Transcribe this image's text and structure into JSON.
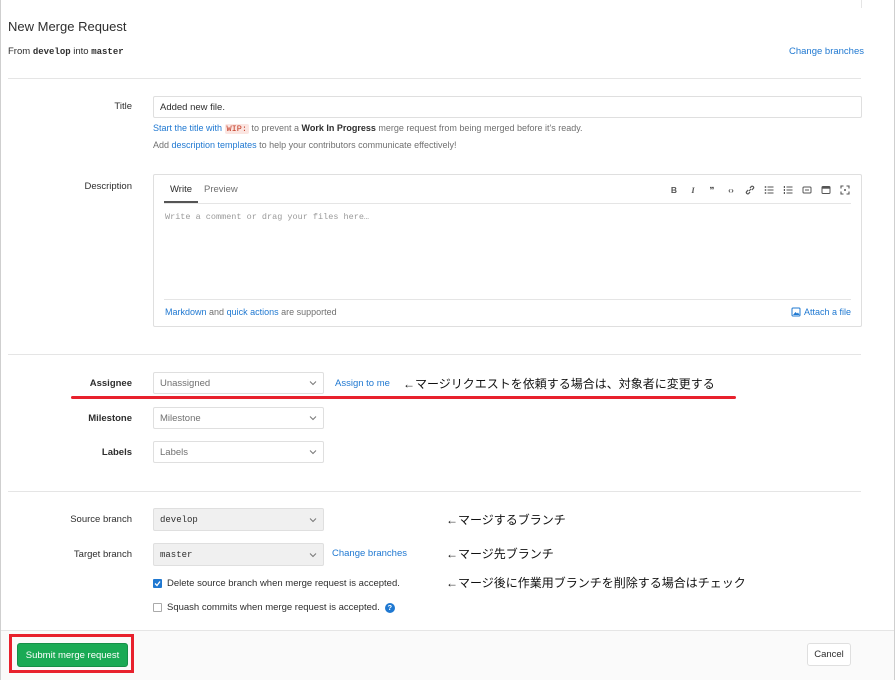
{
  "header": {
    "title": "New Merge Request",
    "from_prefix": "From",
    "source": "develop",
    "into": "into",
    "target": "master",
    "change_branches": "Change branches"
  },
  "title_field": {
    "label": "Title",
    "value": "Added new file.",
    "help1_start": "Start the title with",
    "wip_code": "WIP:",
    "help1_mid": "to prevent a",
    "help1_bold": "Work In Progress",
    "help1_end": "merge request from being merged before it's ready.",
    "help2_start": "Add",
    "help2_link": "description templates",
    "help2_end": "to help your contributors communicate effectively!"
  },
  "description": {
    "label": "Description",
    "tab_write": "Write",
    "tab_preview": "Preview",
    "toolbar": {
      "bold": "B",
      "italic": "I",
      "quote": "❞",
      "code": "‹›"
    },
    "placeholder": "Write a comment or drag your files here…",
    "footer_link1": "Markdown",
    "footer_and": "and",
    "footer_link2": "quick actions",
    "footer_end": "are supported",
    "attach": "Attach a file"
  },
  "assignee": {
    "label": "Assignee",
    "value": "Unassigned",
    "assign_to_me": "Assign to me",
    "annotation": "←マージリクエストを依頼する場合は、対象者に変更する"
  },
  "milestone": {
    "label": "Milestone",
    "value": "Milestone"
  },
  "labels": {
    "label": "Labels",
    "value": "Labels"
  },
  "source_branch": {
    "label": "Source branch",
    "value": "develop",
    "annotation": "←マージするブランチ"
  },
  "target_branch": {
    "label": "Target branch",
    "value": "master",
    "change_branches": "Change branches",
    "annotation": "←マージ先ブランチ"
  },
  "delete_source": {
    "label": "Delete source branch when merge request is accepted.",
    "checked": true,
    "annotation": "←マージ後に作業用ブランチを削除する場合はチェック"
  },
  "squash": {
    "label": "Squash commits when merge request is accepted.",
    "checked": false,
    "help_icon": "?"
  },
  "actions": {
    "submit": "Submit merge request",
    "cancel": "Cancel"
  },
  "colors": {
    "link": "#1f78d1",
    "submit": "#1aaa55",
    "annotation_red": "#e8212d"
  }
}
